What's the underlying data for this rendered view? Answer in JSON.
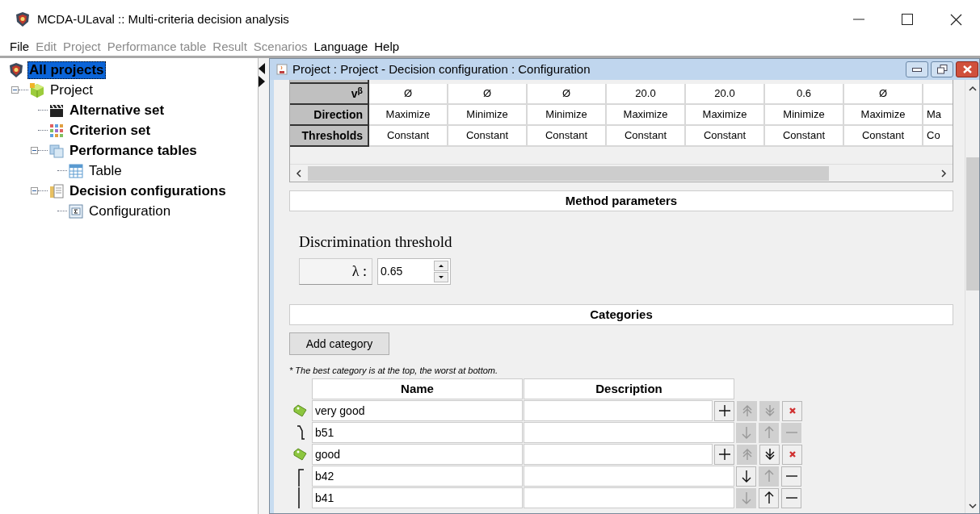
{
  "window": {
    "title": "MCDA-ULaval :: Multi-criteria decision analysis"
  },
  "menu": [
    {
      "label": "File",
      "disabled": false
    },
    {
      "label": "Edit",
      "disabled": true
    },
    {
      "label": "Project",
      "disabled": true
    },
    {
      "label": "Performance table",
      "disabled": true
    },
    {
      "label": "Result",
      "disabled": true
    },
    {
      "label": "Scenarios",
      "disabled": true
    },
    {
      "label": "Language",
      "disabled": false
    },
    {
      "label": "Help",
      "disabled": false
    }
  ],
  "tree": [
    {
      "label": "All projects",
      "kind": "app",
      "bold": true,
      "selected": true,
      "children": [
        {
          "label": "Project",
          "kind": "project",
          "bold": false,
          "selected": false,
          "expanded": true,
          "children": [
            {
              "label": "Alternative set",
              "kind": "alternatives",
              "bold": true,
              "selected": false
            },
            {
              "label": "Criterion set",
              "kind": "criteria",
              "bold": true,
              "selected": false
            },
            {
              "label": "Performance tables",
              "kind": "tables",
              "bold": true,
              "selected": false,
              "expanded": true,
              "children": [
                {
                  "label": "Table",
                  "kind": "table",
                  "bold": false,
                  "selected": false
                }
              ]
            },
            {
              "label": "Decision configurations",
              "kind": "configs",
              "bold": true,
              "selected": false,
              "expanded": true,
              "children": [
                {
                  "label": "Configuration",
                  "kind": "config",
                  "bold": false,
                  "selected": false
                }
              ]
            }
          ]
        }
      ]
    }
  ],
  "inner_window": {
    "title": "Project : Project - Decision configuration : Configuration"
  },
  "criteria_table": {
    "rows": [
      {
        "header": "v$^{β}$",
        "cells": [
          "Ø",
          "Ø",
          "Ø",
          "20.0",
          "20.0",
          "0.6",
          "Ø"
        ]
      },
      {
        "header": "Direction",
        "cells": [
          "Maximize",
          "Minimize",
          "Minimize",
          "Maximize",
          "Maximize",
          "Minimize",
          "Maximize",
          "Ma"
        ]
      },
      {
        "header": "Thresholds",
        "cells": [
          "Constant",
          "Constant",
          "Constant",
          "Constant",
          "Constant",
          "Constant",
          "Constant",
          "Co"
        ]
      }
    ]
  },
  "method_parameters": {
    "title": "Method parameters",
    "label": "Discrimination threshold",
    "parameter": "λ :",
    "value": "0.65"
  },
  "categories": {
    "title": "Categories",
    "add_button": "Add category",
    "note": "* The best category is at the top, the worst at bottom.",
    "columns": [
      "Name",
      "Description"
    ],
    "rows": [
      {
        "kind": "category",
        "name": "very good",
        "buttons": [
          {
            "kind": "add",
            "disabled": false
          },
          {
            "kind": "up-double",
            "disabled": true
          },
          {
            "kind": "down-double",
            "disabled": true
          },
          {
            "kind": "delete",
            "disabled": false
          }
        ]
      },
      {
        "kind": "boundary",
        "name": "b51",
        "buttons": [
          {
            "kind": "down",
            "disabled": true
          },
          {
            "kind": "up",
            "disabled": true
          },
          {
            "kind": "remove",
            "disabled": true
          }
        ]
      },
      {
        "kind": "category",
        "name": "good",
        "buttons": [
          {
            "kind": "add",
            "disabled": false
          },
          {
            "kind": "up-double",
            "disabled": true
          },
          {
            "kind": "down-double",
            "disabled": false
          },
          {
            "kind": "delete",
            "disabled": false
          }
        ]
      },
      {
        "kind": "boundary",
        "name": "b42",
        "buttons": [
          {
            "kind": "down",
            "disabled": false
          },
          {
            "kind": "up",
            "disabled": true
          },
          {
            "kind": "remove",
            "disabled": false
          }
        ]
      },
      {
        "kind": "boundary",
        "name": "b41",
        "buttons": [
          {
            "kind": "down",
            "disabled": true
          },
          {
            "kind": "up",
            "disabled": false
          },
          {
            "kind": "remove",
            "disabled": false
          }
        ]
      }
    ]
  }
}
